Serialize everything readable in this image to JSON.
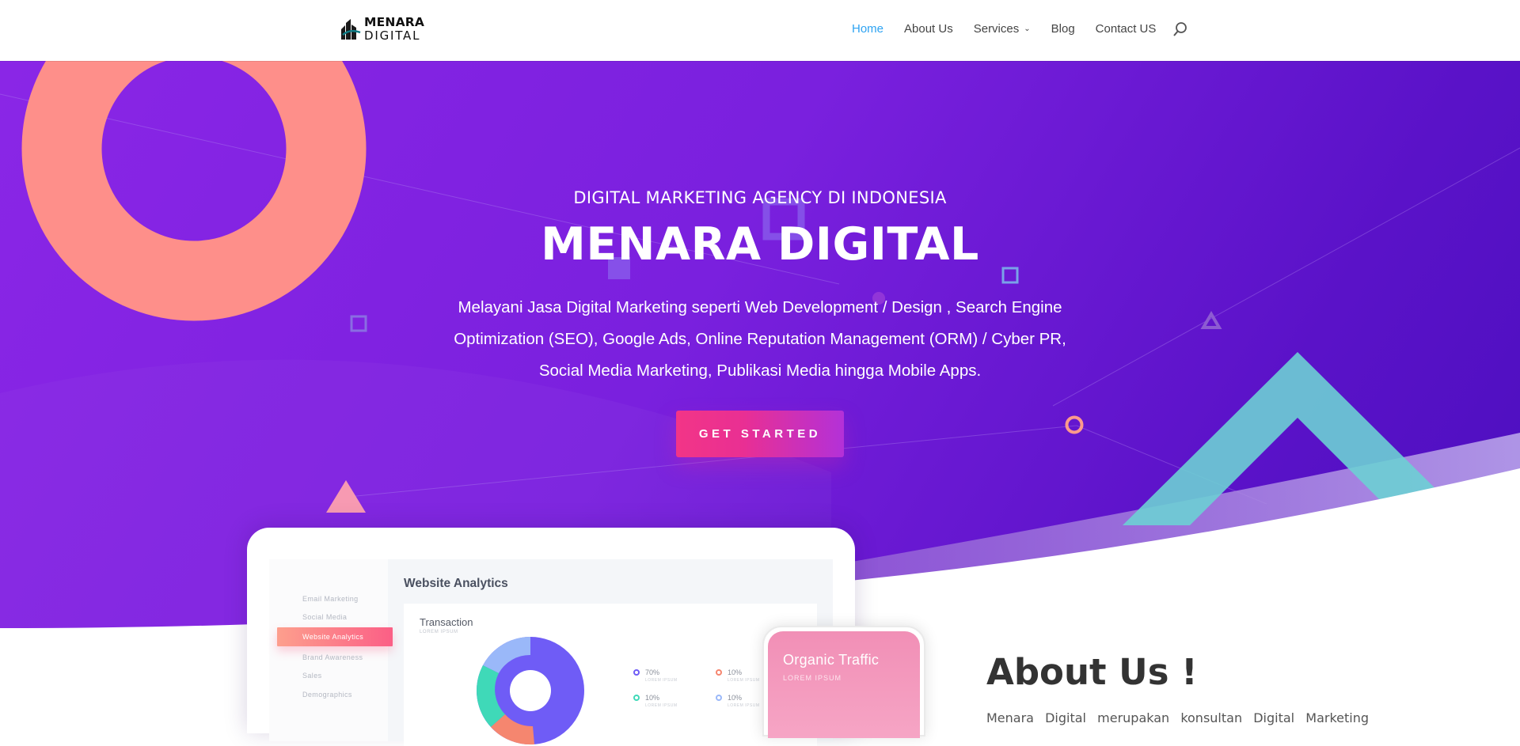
{
  "header": {
    "logo": {
      "line1": "MENARA",
      "line2": "DIGITAL"
    },
    "nav": [
      {
        "label": "Home",
        "active": true
      },
      {
        "label": "About Us"
      },
      {
        "label": "Services",
        "has_dropdown": true
      },
      {
        "label": "Blog"
      },
      {
        "label": "Contact US"
      }
    ],
    "search_icon": "search-icon"
  },
  "hero": {
    "subtitle": "DIGITAL MARKETING AGENCY DI INDONESIA",
    "title": "MENARA DIGITAL",
    "description_lines": [
      "Melayani Jasa Digital Marketing seperti Web Development / Design , Search Engine",
      "Optimization (SEO), Google Ads, Online Reputation Management (ORM) / Cyber PR,",
      "Social Media Marketing, Publikasi Media hingga Mobile Apps."
    ],
    "cta_label": "GET STARTED"
  },
  "dashboard": {
    "sidebar": [
      "Email Marketing",
      "Social Media",
      "Website Analytics",
      "Brand Awareness",
      "Sales",
      "Demographics"
    ],
    "active_item": "Website Analytics",
    "title": "Website Analytics",
    "card_title": "Transaction",
    "card_subtitle": "LOREM IPSUM",
    "legend": [
      {
        "value": "70%",
        "sub": "LOREM IPSUM",
        "color": "#6f5cf6"
      },
      {
        "value": "10%",
        "sub": "LOREM IPSUM",
        "color": "#f5866f"
      },
      {
        "value": "10%",
        "sub": "LOREM IPSUM",
        "color": "#3fd9b8"
      },
      {
        "value": "10%",
        "sub": "LOREM IPSUM",
        "color": "#9ab8f9"
      }
    ]
  },
  "phone": {
    "title": "Organic Traffic",
    "subtitle": "LOREM IPSUM"
  },
  "about": {
    "title": "About Us !",
    "text": "Menara Digital merupakan konsultan Digital Marketing"
  },
  "colors": {
    "brand_purple": "#7a20de",
    "accent_pink": "#f23587",
    "nav_active": "#2ea3f2",
    "coral": "#fe8f8a",
    "teal": "#6dcfd4"
  }
}
